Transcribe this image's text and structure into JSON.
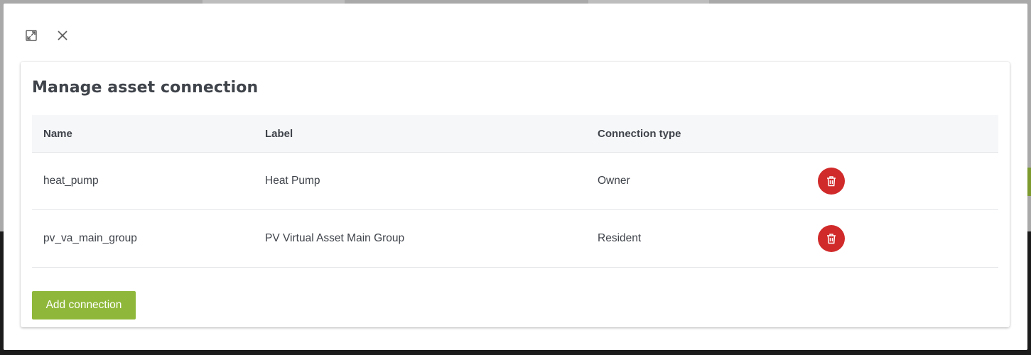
{
  "modal": {
    "title": "Manage asset connection",
    "toolbar": {
      "expand_icon": "expand-icon",
      "close_icon": "close-icon"
    }
  },
  "table": {
    "headers": {
      "name": "Name",
      "label": "Label",
      "connection_type": "Connection type"
    },
    "rows": [
      {
        "name": "heat_pump",
        "label": "Heat Pump",
        "connection_type": "Owner",
        "action_icon": "trash-icon"
      },
      {
        "name": "pv_va_main_group",
        "label": "PV Virtual Asset Main Group",
        "connection_type": "Resident",
        "action_icon": "trash-icon"
      }
    ]
  },
  "actions": {
    "add_connection_label": "Add connection"
  },
  "colors": {
    "delete_button": "#d12a2a",
    "add_button": "#8fb83a",
    "text": "#3f434a",
    "header_bg": "#f6f7f8"
  }
}
